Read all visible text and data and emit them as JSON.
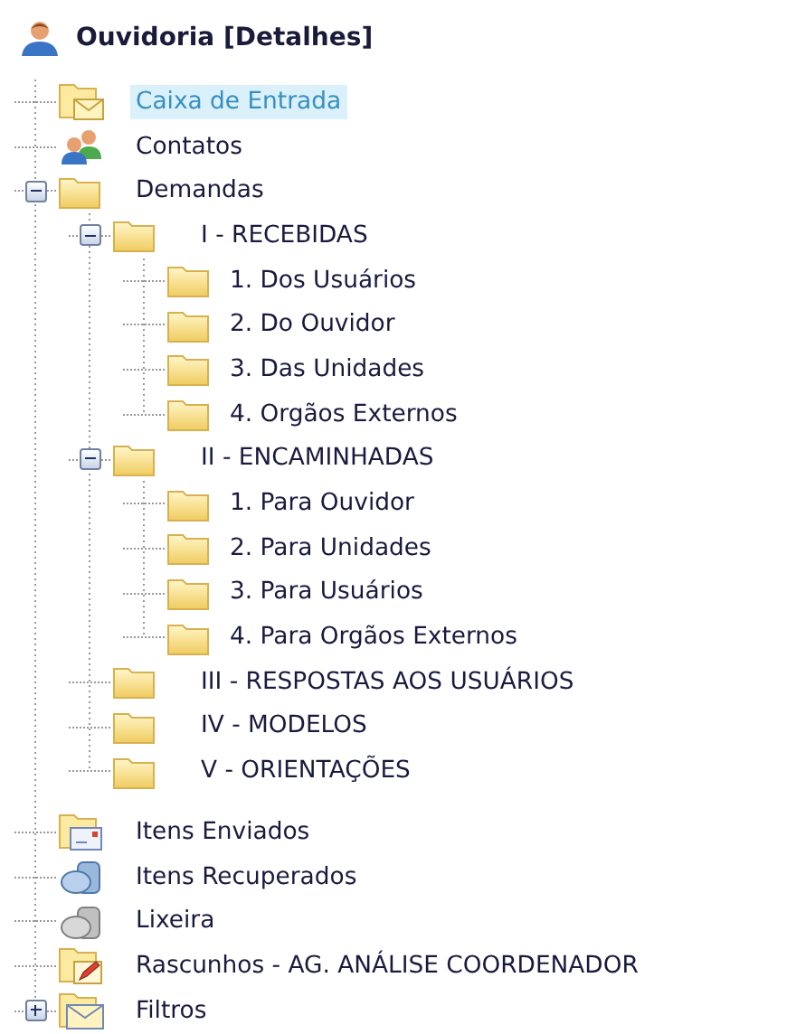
{
  "header": {
    "title": "Ouvidoria [Detalhes]"
  },
  "tree": [
    {
      "label": "Caixa de Entrada",
      "kind": "inbox",
      "selected": true
    },
    {
      "label": "Contatos",
      "kind": "contacts",
      "selected": false
    },
    {
      "label": "Demandas",
      "kind": "folder",
      "selected": false,
      "expanded": true,
      "children": [
        {
          "label": "I - RECEBIDAS",
          "kind": "folder",
          "selected": false,
          "expanded": true,
          "children": [
            {
              "label": "1. Dos Usuários",
              "kind": "folder",
              "selected": false
            },
            {
              "label": "2. Do Ouvidor",
              "kind": "folder",
              "selected": false
            },
            {
              "label": "3. Das Unidades",
              "kind": "folder",
              "selected": false
            },
            {
              "label": "4. Orgãos Externos",
              "kind": "folder",
              "selected": false
            }
          ]
        },
        {
          "label": "II - ENCAMINHADAS",
          "kind": "folder",
          "selected": false,
          "expanded": true,
          "children": [
            {
              "label": "1. Para Ouvidor",
              "kind": "folder",
              "selected": false
            },
            {
              "label": "2. Para Unidades",
              "kind": "folder",
              "selected": false
            },
            {
              "label": "3. Para Usuários",
              "kind": "folder",
              "selected": false
            },
            {
              "label": "4. Para Orgãos Externos",
              "kind": "folder",
              "selected": false
            }
          ]
        },
        {
          "label": "III - RESPOSTAS AOS USUÁRIOS",
          "kind": "folder",
          "selected": false
        },
        {
          "label": "IV - MODELOS",
          "kind": "folder",
          "selected": false
        },
        {
          "label": "V - ORIENTAÇÕES",
          "kind": "folder",
          "selected": false
        }
      ]
    },
    {
      "label": "Itens Enviados",
      "kind": "sent",
      "selected": false
    },
    {
      "label": "Itens Recuperados",
      "kind": "recovered",
      "selected": false
    },
    {
      "label": "Lixeira",
      "kind": "trash",
      "selected": false
    },
    {
      "label": "Rascunhos - AG. ANÁLISE COORDENADOR",
      "kind": "drafts",
      "selected": false
    },
    {
      "label": "Filtros",
      "kind": "filters",
      "selected": false,
      "expanded": false
    }
  ]
}
